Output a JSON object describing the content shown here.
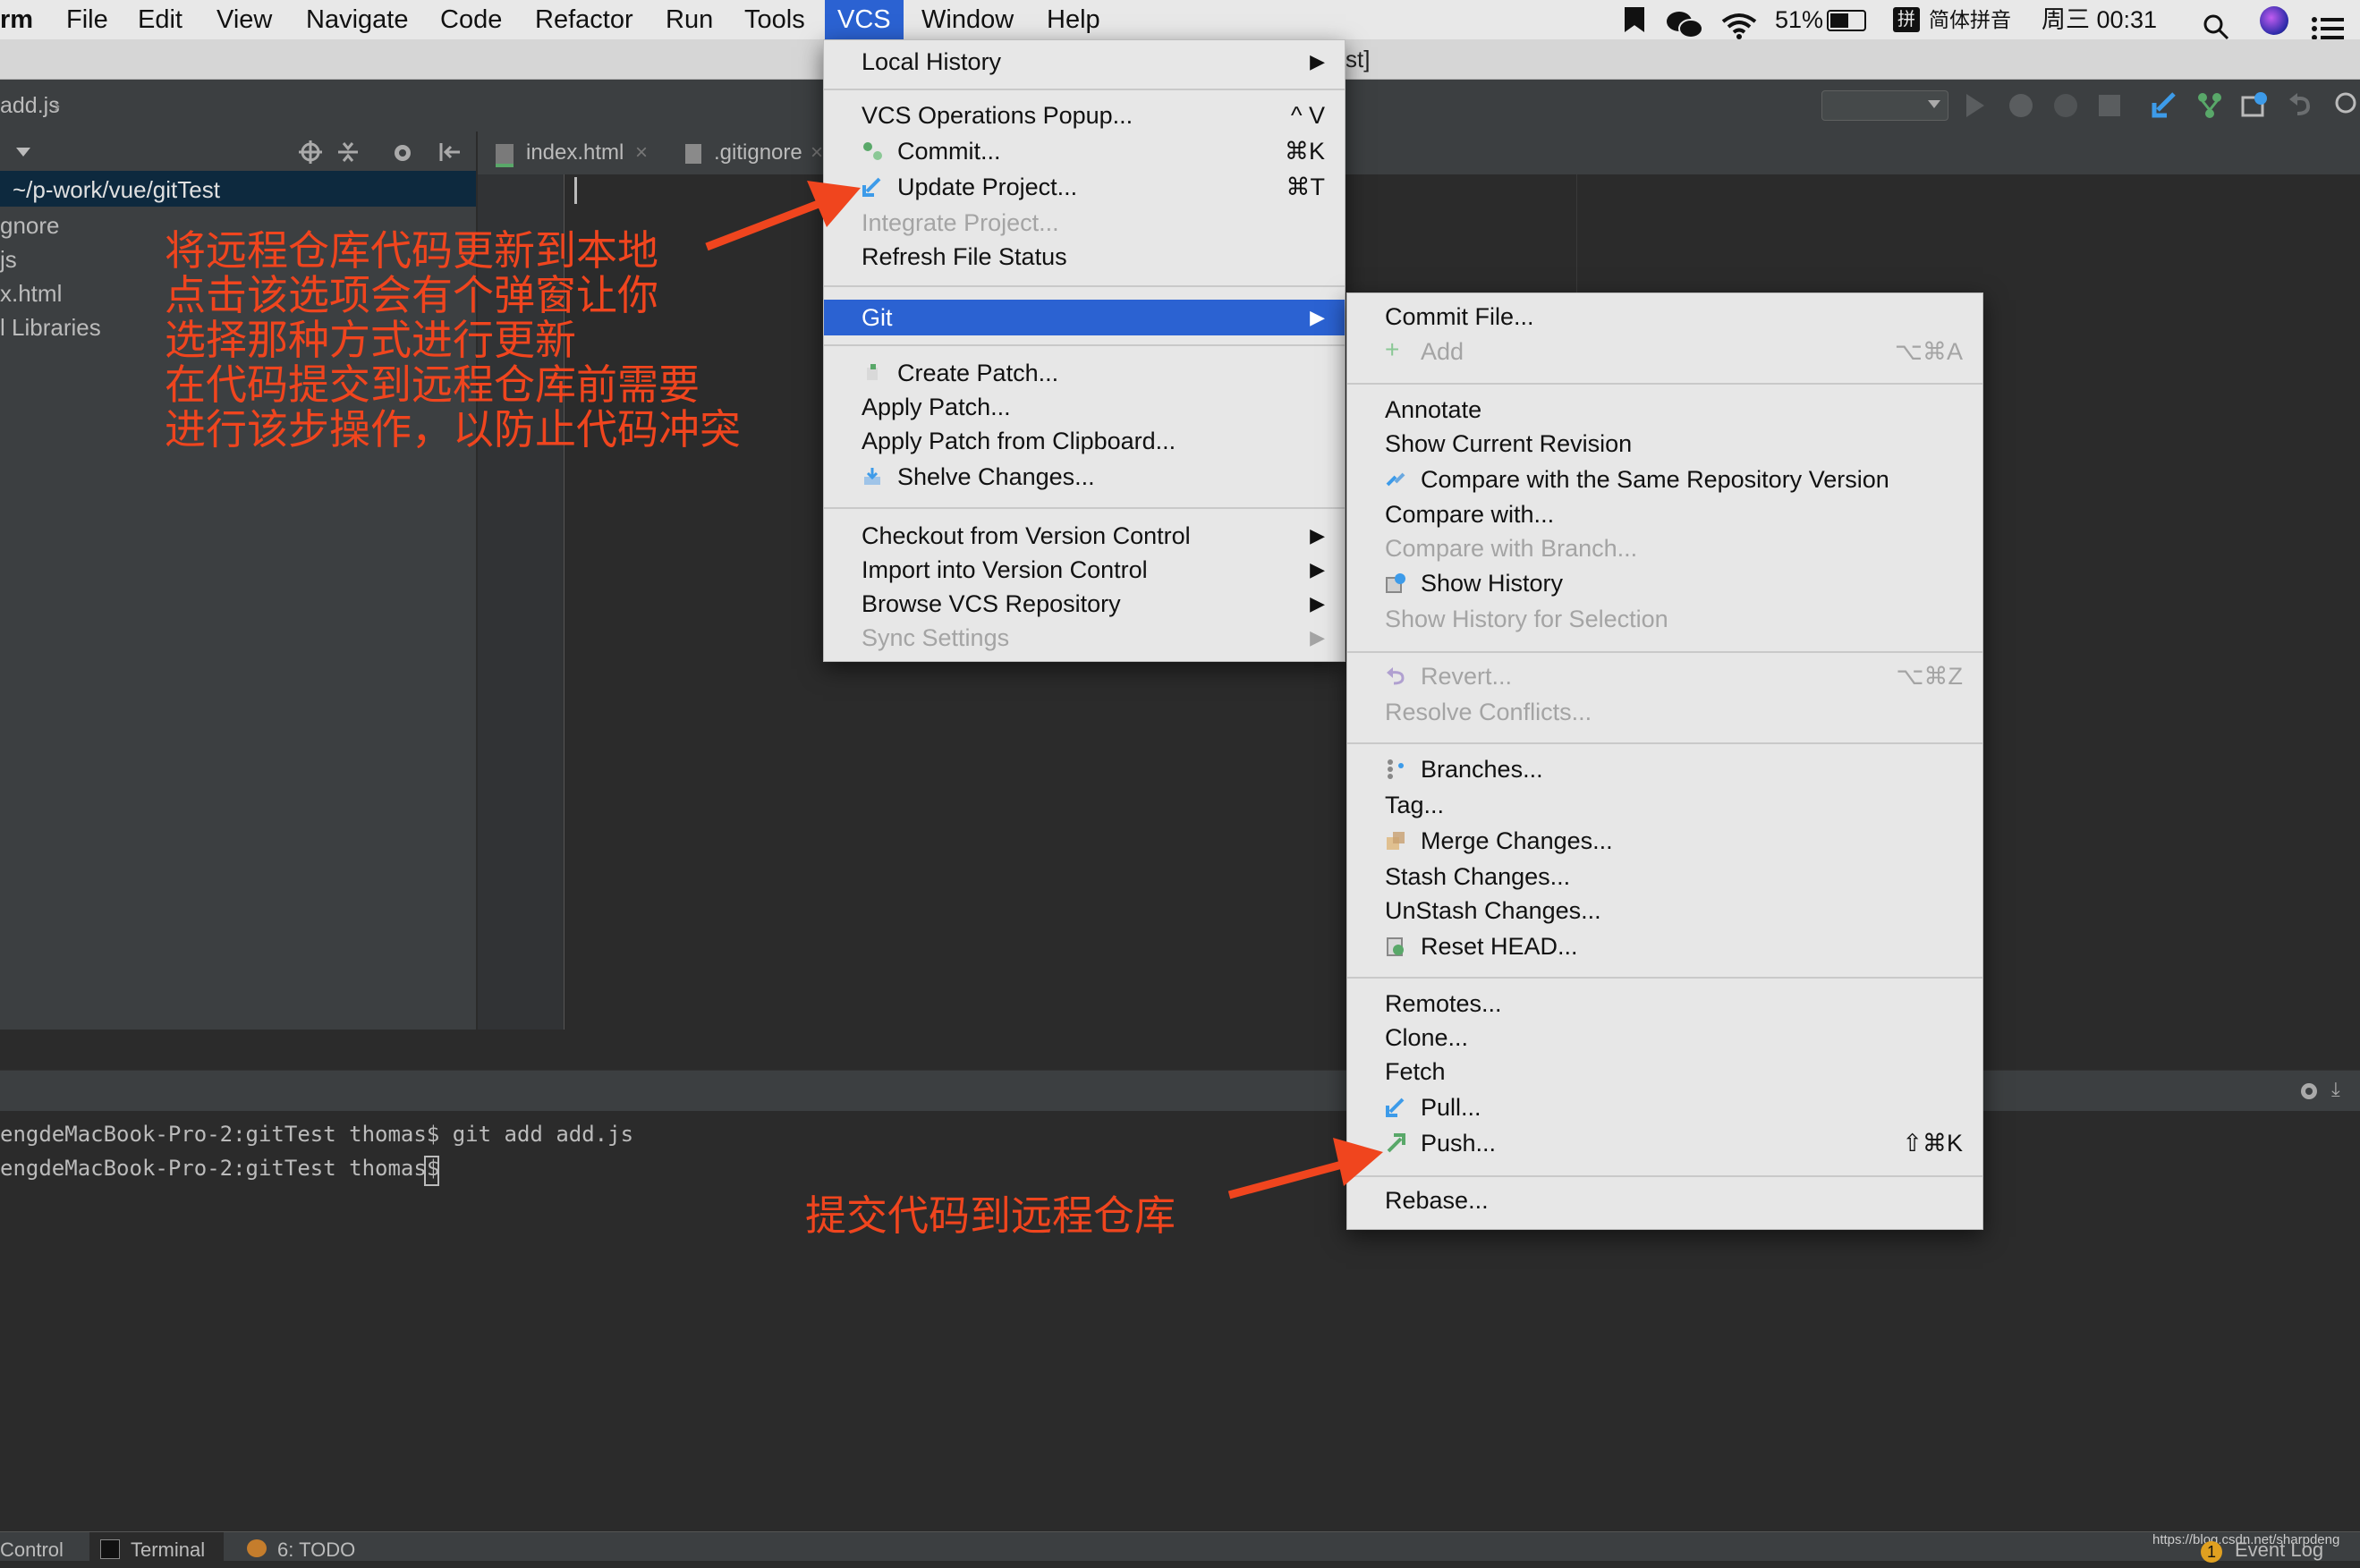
{
  "menubar": {
    "app": "rm",
    "items": [
      "File",
      "Edit",
      "View",
      "Navigate",
      "Code",
      "Refactor",
      "Run",
      "Tools",
      "VCS",
      "Window",
      "Help"
    ],
    "active": "VCS",
    "battery": "51%",
    "input_method": "简体拼音",
    "clock": "周三 00:31",
    "pinyin_glyph": "拼"
  },
  "title_fragment": "st]",
  "breadcrumb": "add.js",
  "project": {
    "root": "~/p-work/vue/gitTest",
    "items": [
      "gnore",
      "js",
      "x.html",
      "l Libraries"
    ]
  },
  "editor_tabs": [
    {
      "label": "index.html"
    },
    {
      "label": ".gitignore"
    }
  ],
  "terminal": {
    "lines": [
      "engdeMacBook-Pro-2:gitTest thomas$ git add add.js",
      "engdeMacBook-Pro-2:gitTest thomas$ "
    ]
  },
  "statusbar": {
    "left": [
      "Control",
      "Terminal",
      "6: TODO"
    ],
    "right": "Event Log",
    "badge": "1",
    "watermark": "https://blog.csdn.net/sharpdeng"
  },
  "vcs_menu": {
    "groups": [
      [
        {
          "label": "Local History",
          "submenu": true
        }
      ],
      [
        {
          "label": "VCS Operations Popup...",
          "shortcut": "^ V"
        },
        {
          "label": "Commit...",
          "shortcut": "⌘K",
          "icon": "commit-icon"
        },
        {
          "label": "Update Project...",
          "shortcut": "⌘T",
          "icon": "update-icon"
        },
        {
          "label": "Integrate Project...",
          "disabled": true
        },
        {
          "label": "Refresh File Status"
        }
      ],
      [
        {
          "label": "Git",
          "submenu": true,
          "selected": true
        }
      ],
      [
        {
          "label": "Create Patch...",
          "icon": "patch-icon"
        },
        {
          "label": "Apply Patch..."
        },
        {
          "label": "Apply Patch from Clipboard..."
        },
        {
          "label": "Shelve Changes...",
          "icon": "shelve-icon"
        }
      ],
      [
        {
          "label": "Checkout from Version Control",
          "submenu": true
        },
        {
          "label": "Import into Version Control",
          "submenu": true
        },
        {
          "label": "Browse VCS Repository",
          "submenu": true
        },
        {
          "label": "Sync Settings",
          "submenu": true,
          "disabled": true
        }
      ]
    ]
  },
  "git_menu": {
    "groups": [
      [
        {
          "label": "Commit File..."
        },
        {
          "label": "Add",
          "shortcut": "⌥⌘A",
          "disabled": true,
          "icon": "add-icon"
        }
      ],
      [
        {
          "label": "Annotate"
        },
        {
          "label": "Show Current Revision"
        },
        {
          "label": "Compare with the Same Repository Version",
          "icon": "compare-icon"
        },
        {
          "label": "Compare with..."
        },
        {
          "label": "Compare with Branch...",
          "disabled": true
        },
        {
          "label": "Show History",
          "icon": "history-icon"
        },
        {
          "label": "Show History for Selection",
          "disabled": true
        }
      ],
      [
        {
          "label": "Revert...",
          "shortcut": "⌥⌘Z",
          "disabled": true,
          "icon": "revert-icon"
        },
        {
          "label": "Resolve Conflicts...",
          "disabled": true
        }
      ],
      [
        {
          "label": "Branches...",
          "icon": "branches-icon"
        },
        {
          "label": "Tag..."
        },
        {
          "label": "Merge Changes...",
          "icon": "merge-icon"
        },
        {
          "label": "Stash Changes..."
        },
        {
          "label": "UnStash Changes..."
        },
        {
          "label": "Reset HEAD...",
          "icon": "reset-icon"
        }
      ],
      [
        {
          "label": "Remotes..."
        },
        {
          "label": "Clone..."
        },
        {
          "label": "Fetch"
        },
        {
          "label": "Pull...",
          "icon": "pull-icon"
        },
        {
          "label": "Push...",
          "shortcut": "⇧⌘K",
          "icon": "push-icon"
        }
      ],
      [
        {
          "label": "Rebase..."
        }
      ]
    ]
  },
  "annotations": {
    "update_note": [
      "将远程仓库代码更新到本地",
      "点击该选项会有个弹窗让你",
      "选择那种方式进行更新",
      "在代码提交到远程仓库前需要",
      "进行该步操作，以防止代码冲突"
    ],
    "push_note": "提交代码到远程仓库"
  },
  "colors": {
    "accent": "#2b62d2",
    "annotation": "#f0451e"
  }
}
